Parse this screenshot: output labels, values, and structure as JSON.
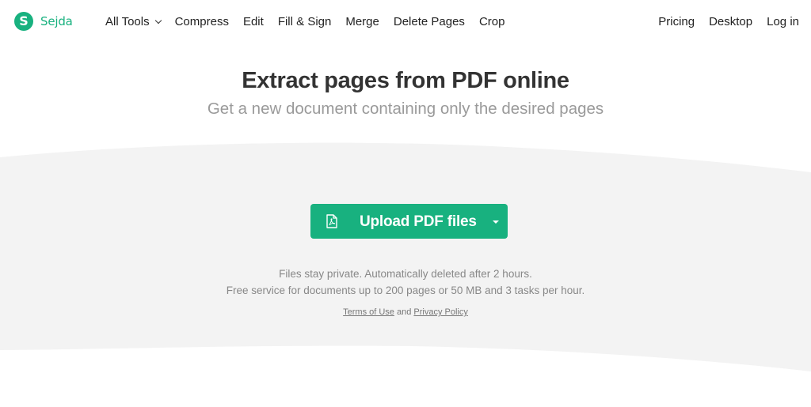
{
  "brand": {
    "name": "Sejda",
    "logo_letter": "S",
    "color": "#18b17f"
  },
  "nav": {
    "left": [
      "All Tools",
      "Compress",
      "Edit",
      "Fill & Sign",
      "Merge",
      "Delete Pages",
      "Crop"
    ],
    "right": [
      "Pricing",
      "Desktop",
      "Log in"
    ]
  },
  "hero": {
    "title": "Extract pages from PDF online",
    "subtitle": "Get a new document containing only the desired pages"
  },
  "upload": {
    "label": "Upload PDF files",
    "icon": "pdf-file-icon",
    "dropdown_icon": "caret-down-icon"
  },
  "info": {
    "line1": "Files stay private. Automatically deleted after 2 hours.",
    "line2": "Free service for documents up to 200 pages or 50 MB and 3 tasks per hour."
  },
  "legal": {
    "terms": "Terms of Use",
    "and": "and",
    "privacy": "Privacy Policy"
  }
}
